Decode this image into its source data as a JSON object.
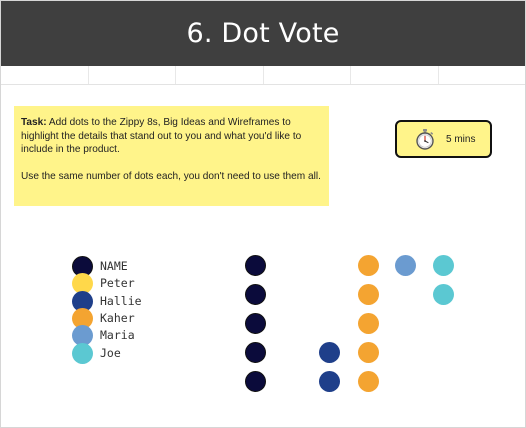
{
  "slide": {
    "title": "6. Dot Vote"
  },
  "task": {
    "label": "Task:",
    "line1": " Add dots to the Zippy 8s, Big Ideas and Wireframes to highlight the details that stand out to you and what you'd like to include in the product.",
    "line2": "Use the same number of dots each, you don't need to use them all."
  },
  "timer": {
    "icon": "stopwatch-icon",
    "label": "5 mins"
  },
  "colors": {
    "title_bar": "#3f3f3f",
    "sticky_yellow": "#fff48a",
    "navy": "#0b0b3b",
    "yellow": "#ffd84a",
    "blue": "#1f3f8a",
    "orange": "#f4a431",
    "light_blue": "#6b9bd0",
    "teal": "#5bc8d2"
  },
  "legend": [
    {
      "name": "NAME",
      "color": "#0b0b3b",
      "outlined": true
    },
    {
      "name": "Peter",
      "color": "#ffd84a",
      "outlined": false
    },
    {
      "name": "Hallie",
      "color": "#1f3f8a",
      "outlined": false
    },
    {
      "name": "Kaher",
      "color": "#f4a431",
      "outlined": false
    },
    {
      "name": "Maria",
      "color": "#6b9bd0",
      "outlined": false
    },
    {
      "name": "Joe",
      "color": "#5bc8d2",
      "outlined": false
    }
  ],
  "vote_dots": [
    {
      "person": "NAME",
      "count": 5
    },
    {
      "person": "Hallie",
      "count": 2
    },
    {
      "person": "Kaher",
      "count": 5
    },
    {
      "person": "Maria",
      "count": 1
    },
    {
      "person": "Joe",
      "count": 2
    }
  ]
}
